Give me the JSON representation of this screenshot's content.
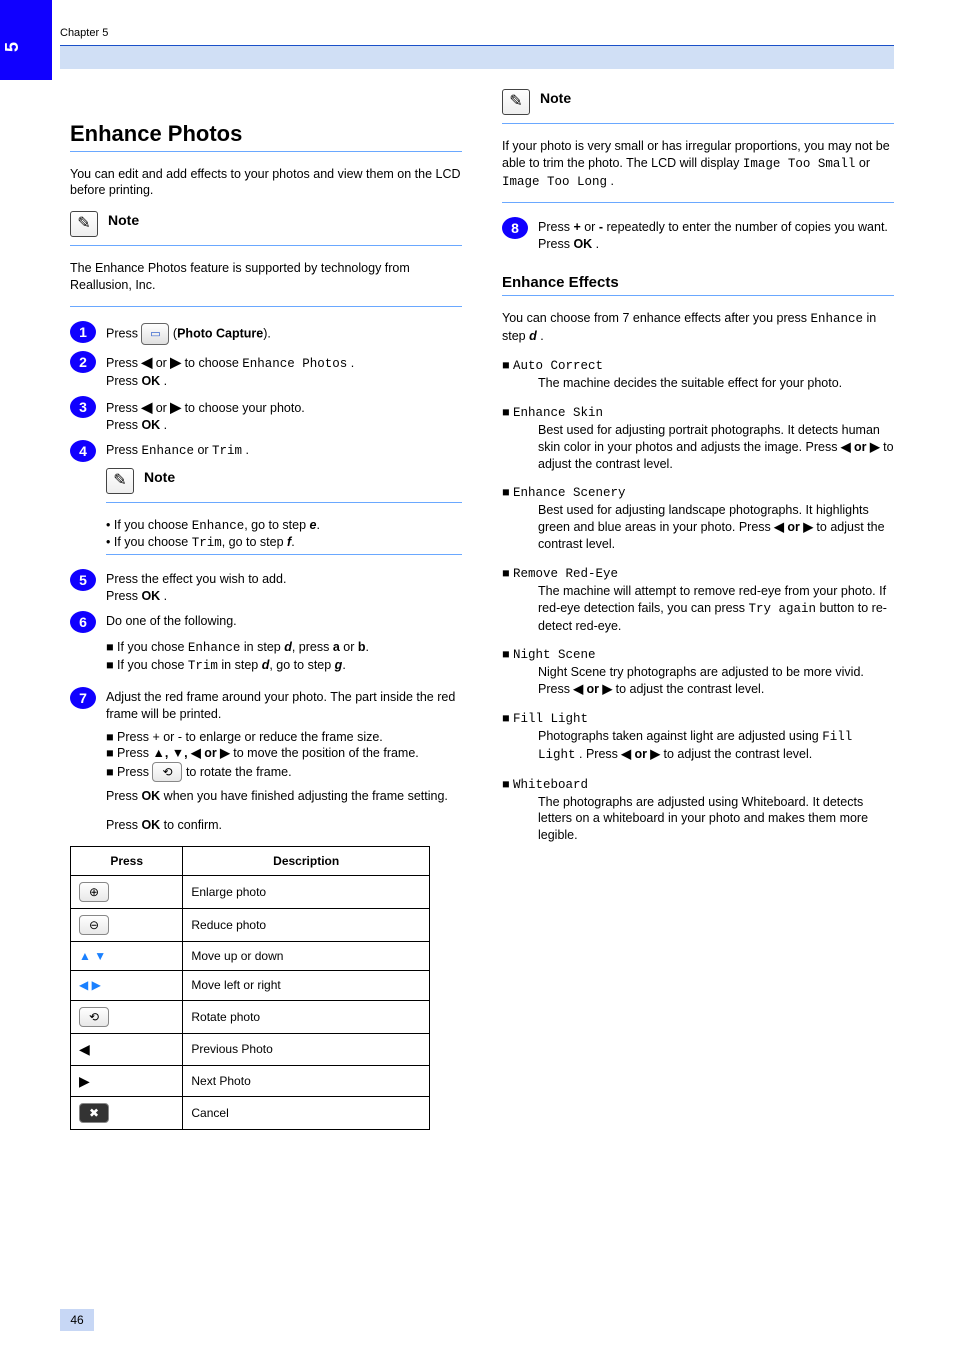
{
  "meta": {
    "chapter_tab": "5",
    "chapter_label": "Chapter 5",
    "page_number": "46"
  },
  "left": {
    "section_title": "Enhance Photos",
    "intro_para": "You can edit and add effects to your photos and view them on the LCD before printing.",
    "note_label": "Note",
    "note_text_full": "The Enhance Photos feature is supported by technology from Reallusion, Inc.",
    "steps": {
      "s1": {
        "text_before": "Press ",
        "text_after": " (",
        "bold": "Photo Capture",
        "tail": ")."
      },
      "s2": {
        "pre": "Press ",
        "mid": " or ",
        "post": " to choose ",
        "option": "Enhance Photos",
        "end": ".",
        "second": "Press ",
        "ok": "OK",
        "second_end": "."
      },
      "s3": {
        "pre": "Press ",
        "mid": " or ",
        "post": " to choose your photo.",
        "second": "Press ",
        "ok": "OK",
        "second_end": "."
      },
      "s4": {
        "pre": "Press ",
        "option": "Enhance",
        "or": " or ",
        "option2": "Trim",
        "end": "."
      },
      "s4_note_label": "Note",
      "s4_note_items": [
        {
          "lead": "If you choose ",
          "bold1": "Enhance",
          "mid": ", go to step ",
          "ref": "e",
          "tail": "."
        },
        {
          "lead": "If you choose ",
          "bold1": "Trim",
          "mid": ", go to step ",
          "ref": "f",
          "tail": "."
        }
      ],
      "s5": {
        "text": "Press the effect you wish to add.",
        "second": "Press ",
        "ok": "OK",
        "end": "."
      },
      "s6": {
        "header": "Do one of the following.",
        "bullets": [
          {
            "lead": "If you chose ",
            "bold1": "Enhance",
            "mid": " in step ",
            "ref": "d",
            "mid2": ", press ",
            "a": "a",
            "or": " or ",
            "b": "b",
            "tail": "."
          },
          {
            "lead": "If you chose ",
            "bold1": "Trim",
            "mid": " in step ",
            "ref": "d",
            "mid2": ", go to step ",
            "ref2": "g",
            "tail": "."
          }
        ]
      },
      "s7": {
        "text_before": "Adjust the red frame around your photo. The part inside the red frame will be printed.",
        "bullets": [
          "Press + or - to enlarge or reduce the frame size.",
          {
            "pre": "Press ",
            "arrows": "▲, ▼, ◀ or ▶",
            "post": " to move the position of the frame."
          },
          {
            "pre": "Press ",
            "icon": "rotate-icon",
            "post": " to rotate the frame."
          }
        ],
        "final_pre": "Press ",
        "final_ok": "OK",
        "final_mid": " when you have finished adjusting the frame setting.",
        "final2_pre": "Press ",
        "final2_ok": "OK",
        "final2_post": " to confirm."
      }
    },
    "table": {
      "headers": [
        "Press",
        "Description"
      ],
      "rows": [
        {
          "key_icon": "zoom-in-icon",
          "key_glyph": "⊕",
          "desc": "Enlarge photo"
        },
        {
          "key_icon": "zoom-out-icon",
          "key_glyph": "⊖",
          "desc": "Reduce photo"
        },
        {
          "key_icon": "arrow-up-down-icon",
          "key_glyph": "▲  ▼",
          "desc": "Move up or down"
        },
        {
          "key_icon": "arrow-left-right-icon",
          "key_glyph": "◀  ▶",
          "desc": "Move left or right"
        },
        {
          "key_icon": "rotate-icon",
          "key_glyph": "⟲",
          "desc": "Rotate photo"
        },
        {
          "key_icon": "prev-icon",
          "key_glyph": "◀",
          "desc": "Previous Photo"
        },
        {
          "key_icon": "next-icon",
          "key_glyph": "▶",
          "desc": "Next Photo"
        },
        {
          "key_icon": "cancel-icon",
          "key_glyph": "✖",
          "desc": "Cancel"
        }
      ]
    }
  },
  "right": {
    "note_label": "Note",
    "note_ref_pre": "If your photo is very small or has irregular proportions, you may not be able to trim the photo. The LCD will display ",
    "note_ref_lcd": "Image Too Small",
    "note_ref_mid": " or ",
    "note_ref_lcd2": "Image Too Long",
    "note_ref_end": ".",
    "step8": {
      "pre": "Press ",
      "bold1": "+",
      "or": " or ",
      "bold2": "-",
      "post": " repeatedly to enter the number of copies you want.",
      "second": "Press ",
      "ok": "OK",
      "end": "."
    },
    "section2": "Enhance Effects",
    "para1_pre": "You can choose from 7 enhance effects after you press ",
    "para1_bold": "Enhance",
    "para1_mid": " in step ",
    "para1_ref": "d",
    "para1_end": ".",
    "effects": [
      {
        "name": "Auto Correct",
        "desc": "The machine decides the suitable effect for your photo."
      },
      {
        "name": "Enhance Skin",
        "desc_pre": "Best used for adjusting portrait photographs. It detects human skin color in your photos and adjusts the image. Press ",
        "arrows": "◀ or ▶",
        "desc_post": " to adjust the contrast level."
      },
      {
        "name": "Enhance Scenery",
        "desc_pre": "Best used for adjusting landscape photographs. It highlights green and blue areas in your photo. Press ",
        "arrows": "◀ or ▶",
        "desc_post": " to adjust the contrast level."
      },
      {
        "name": "Remove Red-Eye",
        "desc": "The machine will attempt to remove red-eye from your photo. If red-eye detection fails, you can press ",
        "btn": "Try again",
        "desc_post": " button to re-detect red-eye."
      },
      {
        "name": "Night Scene",
        "desc_pre": "Night Scene try photographs are adjusted to be more vivid. Press ",
        "arrows": "◀ or ▶",
        "desc_post": " to adjust the contrast level."
      },
      {
        "name": "Fill Light",
        "desc_pre": "Photographs taken against light are adjusted using ",
        "bold": "Fill Light",
        "desc_mid": ". Press ",
        "arrows": "◀ or ▶",
        "desc_post": " to adjust the contrast level."
      },
      {
        "name": "Whiteboard",
        "desc": "The photographs are adjusted using Whiteboard. It detects letters on a whiteboard in your photo and makes them more legible."
      }
    ]
  }
}
